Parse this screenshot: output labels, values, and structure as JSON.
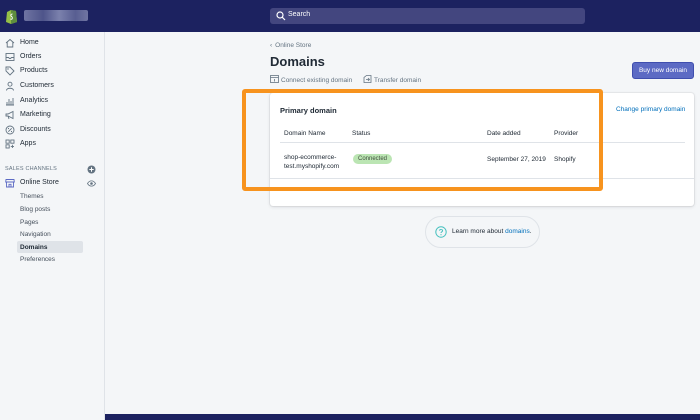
{
  "topbar": {
    "search_placeholder": "Search"
  },
  "sidebar": {
    "items": [
      {
        "label": "Home",
        "icon": "home-icon"
      },
      {
        "label": "Orders",
        "icon": "orders-icon"
      },
      {
        "label": "Products",
        "icon": "tag-icon"
      },
      {
        "label": "Customers",
        "icon": "person-icon"
      },
      {
        "label": "Analytics",
        "icon": "bar-chart-icon"
      },
      {
        "label": "Marketing",
        "icon": "megaphone-icon"
      },
      {
        "label": "Discounts",
        "icon": "discount-icon"
      },
      {
        "label": "Apps",
        "icon": "apps-icon"
      }
    ],
    "section_title": "SALES CHANNELS",
    "channel": "Online Store",
    "sub_items": [
      "Themes",
      "Blog posts",
      "Pages",
      "Navigation",
      "Domains",
      "Preferences"
    ],
    "active_sub_item": "Domains"
  },
  "main": {
    "breadcrumb": "Online Store",
    "title": "Domains",
    "actions": [
      "Connect existing domain",
      "Transfer domain"
    ],
    "buy_button": "Buy new domain",
    "card": {
      "title": "Primary domain",
      "change_link": "Change primary domain",
      "columns": [
        "Domain Name",
        "Status",
        "Date added",
        "Provider"
      ],
      "row": {
        "domain_line1": "shop-ecommerce-",
        "domain_line2": "test.myshopify.com",
        "status": "Connected",
        "date_added": "September 27, 2019",
        "provider": "Shopify"
      }
    },
    "learn_more": {
      "prefix": "Learn more about ",
      "link": "domains",
      "suffix": "."
    }
  },
  "colors": {
    "topbar": "#1c2260",
    "accent": "#5c6ac4",
    "highlight": "#f7931e",
    "badge": "#bbe5b3",
    "link": "#006fbb"
  }
}
